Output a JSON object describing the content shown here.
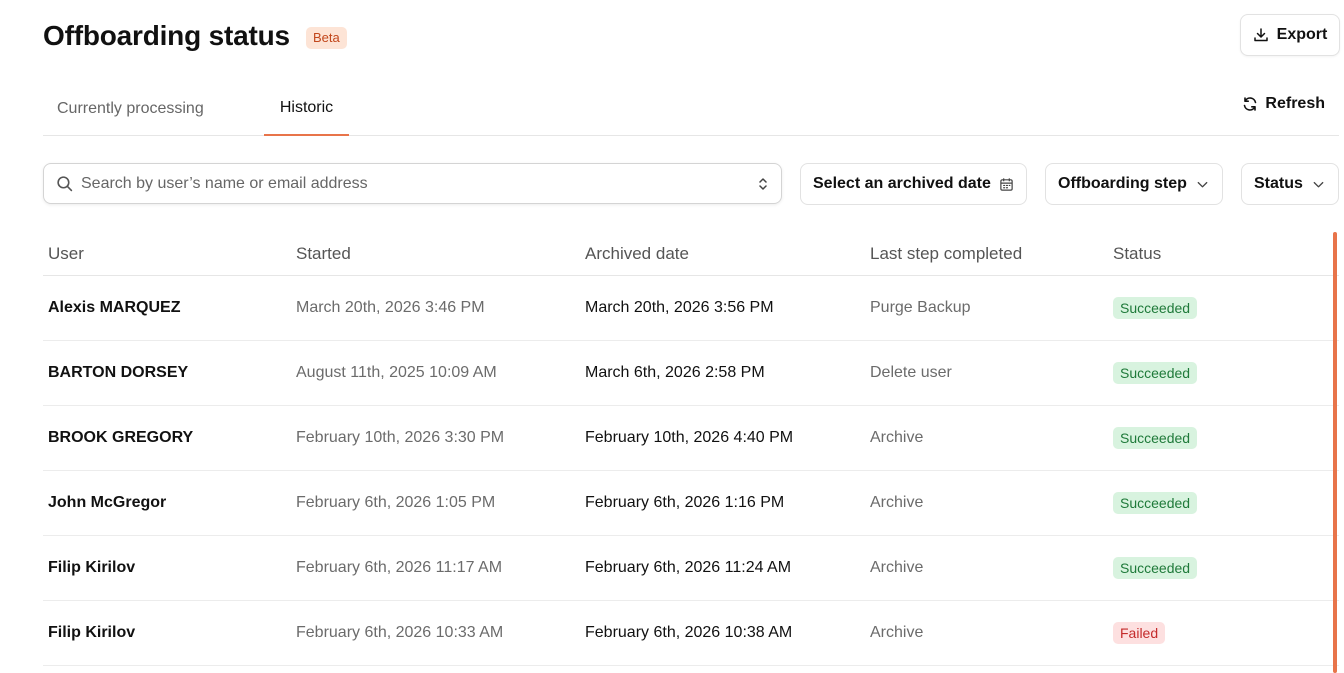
{
  "header": {
    "title": "Offboarding status",
    "badge": "Beta",
    "export_label": "Export"
  },
  "tabs": [
    {
      "label": "Currently processing",
      "active": false
    },
    {
      "label": "Historic",
      "active": true
    }
  ],
  "refresh_label": "Refresh",
  "search": {
    "placeholder": "Search by user’s name or email address",
    "value": ""
  },
  "filters": {
    "date_label": "Select an archived date",
    "step_label": "Offboarding step",
    "status_label": "Status"
  },
  "table": {
    "columns": [
      "User",
      "Started",
      "Archived date",
      "Last step completed",
      "Status"
    ],
    "rows": [
      {
        "user": "Alexis MARQUEZ",
        "started": "March 20th, 2026 3:46 PM",
        "archived": "March 20th, 2026 3:56 PM",
        "step": "Purge Backup",
        "status": "Succeeded"
      },
      {
        "user": "BARTON DORSEY",
        "started": "August 11th, 2025 10:09 AM",
        "archived": "March 6th, 2026 2:58 PM",
        "step": "Delete user",
        "status": "Succeeded"
      },
      {
        "user": "BROOK GREGORY",
        "started": "February 10th, 2026 3:30 PM",
        "archived": "February 10th, 2026 4:40 PM",
        "step": "Archive",
        "status": "Succeeded"
      },
      {
        "user": "John McGregor",
        "started": "February 6th, 2026 1:05 PM",
        "archived": "February 6th, 2026 1:16 PM",
        "step": "Archive",
        "status": "Succeeded"
      },
      {
        "user": "Filip Kirilov",
        "started": "February 6th, 2026 11:17 AM",
        "archived": "February 6th, 2026 11:24 AM",
        "step": "Archive",
        "status": "Succeeded"
      },
      {
        "user": "Filip Kirilov",
        "started": "February 6th, 2026 10:33 AM",
        "archived": "February 6th, 2026 10:38 AM",
        "step": "Archive",
        "status": "Failed"
      }
    ]
  },
  "colors": {
    "accent": "#e8744a",
    "success_bg": "#d8f3df",
    "success_fg": "#1f7a3a",
    "failed_bg": "#fde0e0",
    "failed_fg": "#c42b2b"
  },
  "icons": [
    "download-icon",
    "refresh-icon",
    "search-icon",
    "sort-updown-icon",
    "calendar-icon",
    "chevron-down-icon"
  ]
}
